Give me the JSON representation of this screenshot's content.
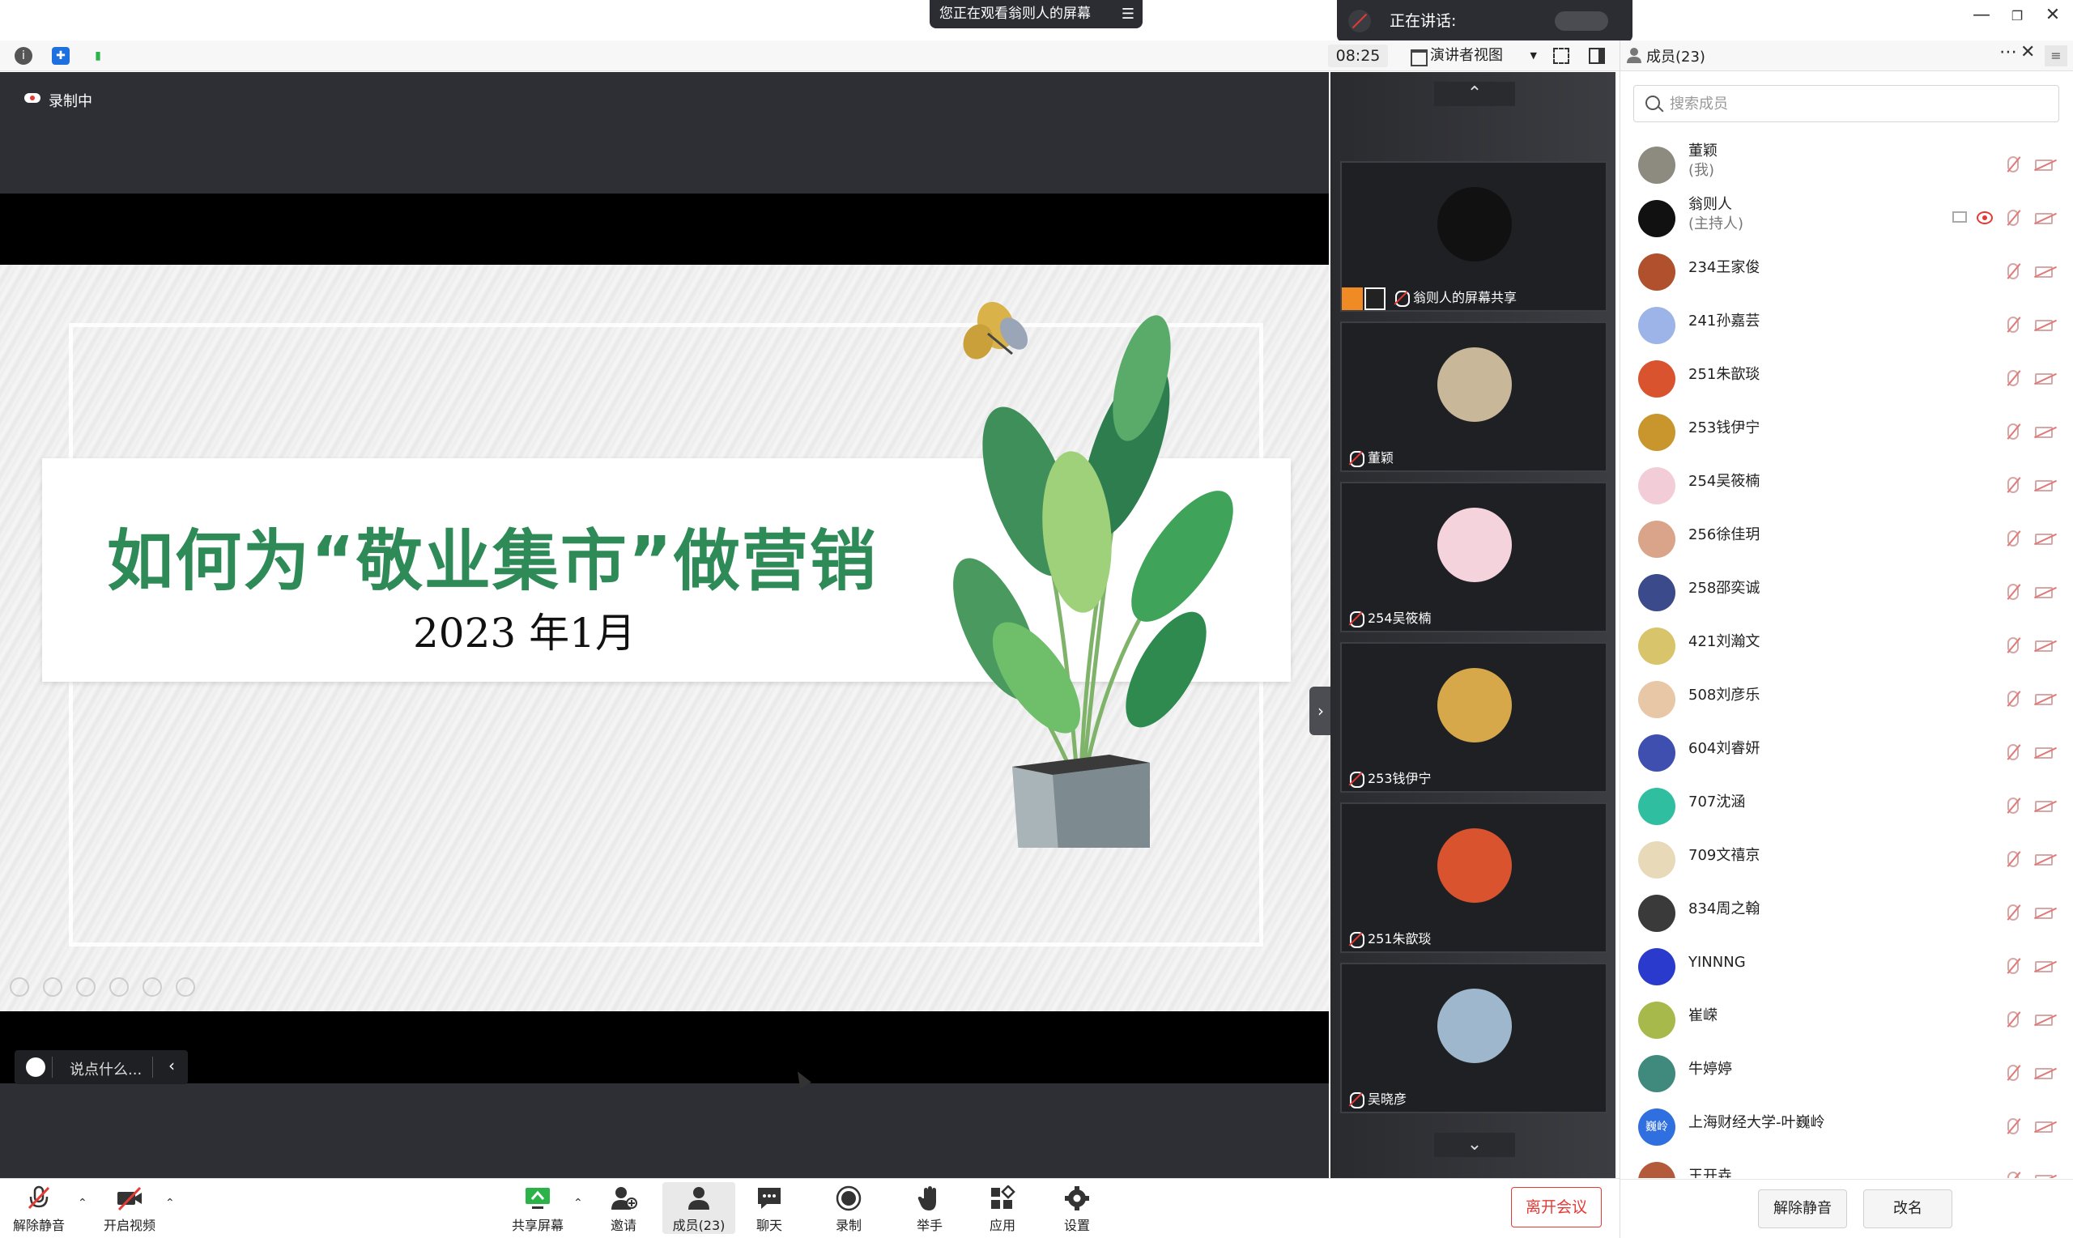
{
  "titlebar": {
    "viewing_banner": "您正在观看翁则人的屏幕",
    "speaking_label": "正在讲话:",
    "window_controls": {
      "minimize": "—",
      "restore": "❐",
      "close": "✕"
    }
  },
  "toolbar2": {
    "time": "08:25",
    "view_mode": "演讲者视图",
    "icons": [
      "info-icon",
      "shield-icon",
      "signal-icon",
      "fullscreen-icon",
      "layout-icon"
    ]
  },
  "main": {
    "recording_label": "录制中",
    "slide": {
      "title": "如何为“敬业集市”做营销",
      "date": "2023 年1月"
    },
    "chat_placeholder": "说点什么..."
  },
  "strip": {
    "tiles": [
      {
        "name": "翁则人的屏幕共享",
        "avatar_color": "#111111"
      },
      {
        "name": "董颖",
        "avatar_color": "#c9b79a"
      },
      {
        "name": "254吴筱楠",
        "avatar_color": "#f4d3dc"
      },
      {
        "name": "253钱伊宁",
        "avatar_color": "#d6a84a"
      },
      {
        "name": "251朱歆琰",
        "avatar_color": "#d9532e"
      },
      {
        "name": "吴晓彦",
        "avatar_color": "#9fb7cc"
      }
    ]
  },
  "bottombar": {
    "unmute": "解除静音",
    "start_video": "开启视频",
    "share_screen": "共享屏幕",
    "invite": "邀请",
    "members": "成员(23)",
    "chat": "聊天",
    "record": "录制",
    "raise_hand": "举手",
    "apps": "应用",
    "settings": "设置",
    "leave": "离开会议"
  },
  "panel": {
    "title": "成员(23)",
    "search_placeholder": "搜索成员",
    "members": [
      {
        "name": "董颖",
        "sub": "(我)",
        "color": "#8d8a80"
      },
      {
        "name": "翁则人",
        "sub": "(主持人)",
        "color": "#111111"
      },
      {
        "name": "234王家俊",
        "sub": "",
        "color": "#b0502d"
      },
      {
        "name": "241孙嘉芸",
        "sub": "",
        "color": "#9db4e8"
      },
      {
        "name": "251朱歆琰",
        "sub": "",
        "color": "#d9532e"
      },
      {
        "name": "253钱伊宁",
        "sub": "",
        "color": "#c9962e"
      },
      {
        "name": "254吴筱楠",
        "sub": "",
        "color": "#f2cdd7"
      },
      {
        "name": "256徐佳玥",
        "sub": "",
        "color": "#d9a48a"
      },
      {
        "name": "258邵奕诚",
        "sub": "",
        "color": "#3a4a8a"
      },
      {
        "name": "421刘瀚文",
        "sub": "",
        "color": "#d8c46a"
      },
      {
        "name": "508刘彦乐",
        "sub": "",
        "color": "#e7c7a5"
      },
      {
        "name": "604刘睿妍",
        "sub": "",
        "color": "#3e4fb0"
      },
      {
        "name": "707沈涵",
        "sub": "",
        "color": "#2fbfa0"
      },
      {
        "name": "709文禧京",
        "sub": "",
        "color": "#e8d9b8"
      },
      {
        "name": "834周之翰",
        "sub": "",
        "color": "#3a3a3a"
      },
      {
        "name": "YINNNG",
        "sub": "",
        "color": "#2a3acc"
      },
      {
        "name": "崔嵘",
        "sub": "",
        "color": "#a7b94a"
      },
      {
        "name": "牛婷婷",
        "sub": "",
        "color": "#3f8a7c"
      },
      {
        "name": "上海财经大学-叶巍岭",
        "sub": "",
        "color": "#2f6fe0",
        "badge": "巍岭"
      },
      {
        "name": "王开垚",
        "sub": "",
        "color": "#b35a3a"
      }
    ],
    "footer": {
      "unmute_all": "解除静音",
      "rename": "改名"
    }
  }
}
